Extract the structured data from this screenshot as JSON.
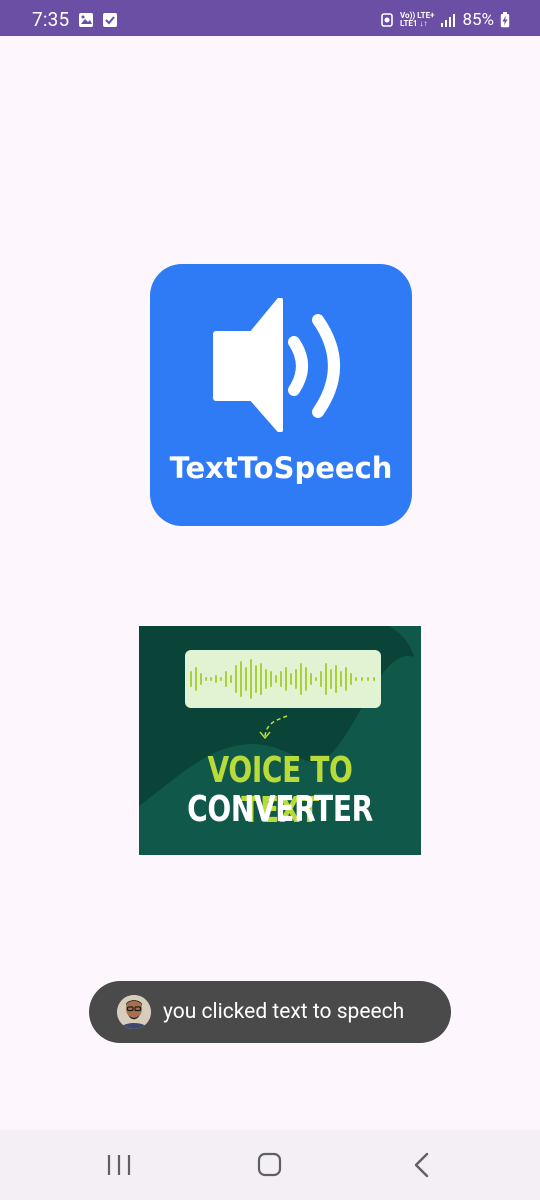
{
  "status_bar": {
    "time": "7:35",
    "left_icons": [
      "gallery-notification-icon",
      "checkbox-notification-icon"
    ],
    "network_top": "Vo)) LTE+",
    "network_bottom": "LTE1 ↓↑",
    "battery_percent": "85%",
    "colors": {
      "background": "#6a4fa5",
      "foreground": "#ffffff"
    }
  },
  "main": {
    "tts_logo": {
      "label": "TextToSpeech",
      "icon": "speaker-volume-icon",
      "background": "#2f7bf5"
    },
    "vtt_banner": {
      "line1": "VOICE TO TEXT",
      "line2": "CONVERTER",
      "icon": "audio-waveform-icon",
      "colors": {
        "background": "#0a4338",
        "accent": "#b9db3a",
        "wave_box": "#e1f3d3"
      }
    }
  },
  "toast": {
    "message": "you clicked text to speech",
    "avatar": "user-avatar"
  },
  "nav_bar": {
    "buttons": [
      "recents-icon",
      "home-icon",
      "back-icon"
    ]
  },
  "colors": {
    "page_background": "#fdf7fd",
    "toast_background": "#4a4a4a"
  }
}
